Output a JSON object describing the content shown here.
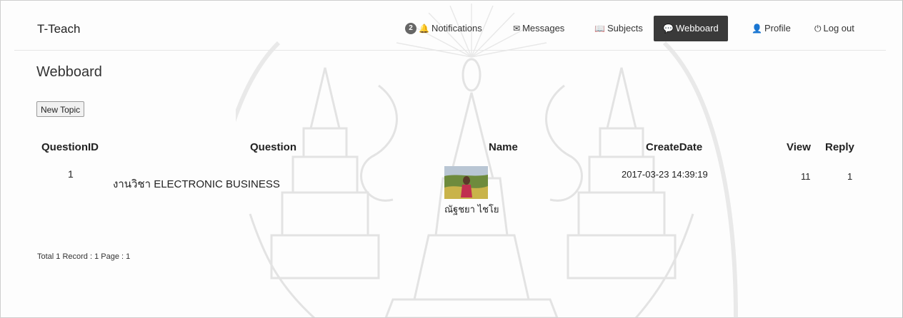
{
  "app": {
    "brand": "T-Teach"
  },
  "nav": {
    "notifications": {
      "badge": "2",
      "label": "Notifications",
      "icon": "bell-icon"
    },
    "messages": {
      "label": "Messages",
      "icon": "envelope-icon"
    },
    "subjects": {
      "label": "Subjects",
      "icon": "book-icon"
    },
    "webboard": {
      "label": "Webboard",
      "icon": "chat-icon",
      "active": true
    },
    "profile": {
      "label": "Profile",
      "icon": "user-icon"
    },
    "logout": {
      "label": "Log out",
      "icon": "power-icon"
    }
  },
  "page": {
    "title": "Webboard",
    "new_topic_label": "New Topic"
  },
  "table": {
    "headers": {
      "id": "QuestionID",
      "question": "Question",
      "name": "Name",
      "created": "CreateDate",
      "view": "View",
      "reply": "Reply"
    },
    "rows": [
      {
        "id": "1",
        "question": "งานวิชา ELECTRONIC BUSINESS",
        "name": "ณัฐชยา ไชโย",
        "created": "2017-03-23 14:39:19",
        "view": "11",
        "reply": "1"
      }
    ]
  },
  "footer": {
    "summary": "Total 1 Record : 1 Page : 1"
  },
  "colors": {
    "active_nav_bg": "#3a3a3a",
    "badge_bg": "#666666",
    "watermark": "#cccccc"
  }
}
